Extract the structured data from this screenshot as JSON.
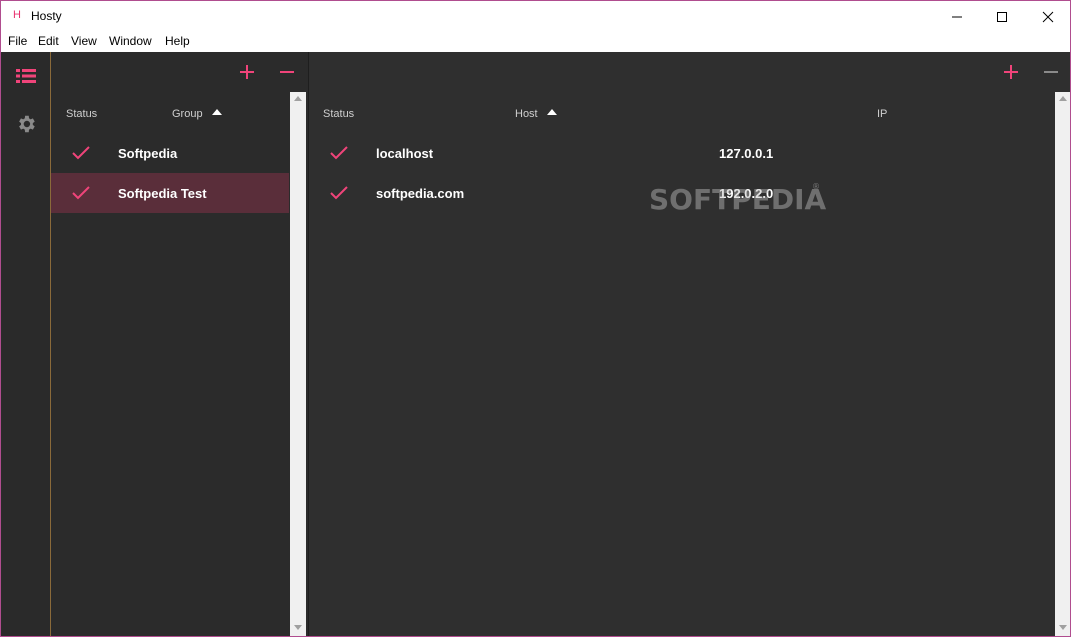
{
  "window": {
    "app_icon": "H",
    "title": "Hosty",
    "controls": [
      "minimize-icon",
      "maximize-icon",
      "close-icon"
    ]
  },
  "menu": [
    "File",
    "Edit",
    "View",
    "Window",
    "Help"
  ],
  "nav": {
    "items": [
      {
        "icon": "list-icon",
        "active": true
      },
      {
        "icon": "gear-icon",
        "active": false
      }
    ]
  },
  "groups": {
    "add_icon": "plus-icon",
    "remove_icon": "minus-icon",
    "columns": {
      "status": "Status",
      "group": "Group"
    },
    "sort": "ascending",
    "rows": [
      {
        "name": "Softpedia",
        "enabled": true,
        "selected": false
      },
      {
        "name": "Softpedia Test",
        "enabled": true,
        "selected": true
      }
    ]
  },
  "hosts": {
    "add_icon": "plus-icon",
    "remove_icon": "minus-icon",
    "columns": {
      "status": "Status",
      "host": "Host",
      "ip": "IP"
    },
    "sort": "ascending",
    "rows": [
      {
        "host": "localhost",
        "ip": "127.0.0.1",
        "enabled": true
      },
      {
        "host": "softpedia.com",
        "ip": "192.0.2.0",
        "enabled": true
      }
    ]
  },
  "watermark": {
    "text": "SOFTPEDIA",
    "mark": "®"
  },
  "colors": {
    "accent": "#f0447a",
    "selected_row": "#5a2e3a",
    "panel_bg": "#2f2f2f"
  }
}
